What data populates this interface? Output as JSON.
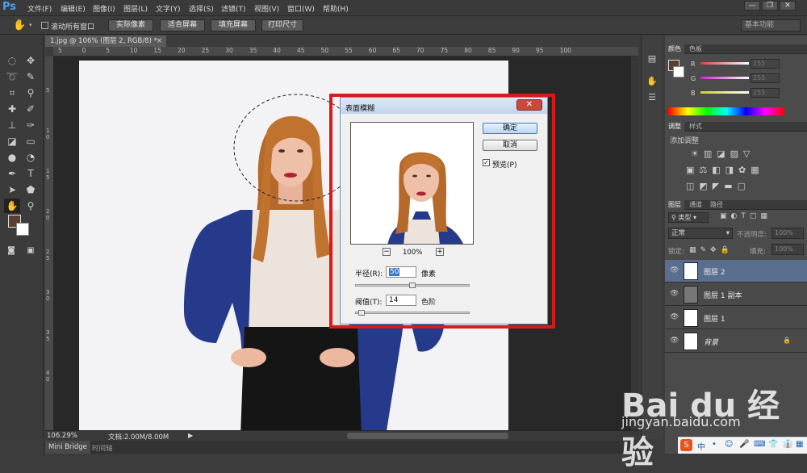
{
  "app": {
    "logo": "Ps"
  },
  "menu": [
    "文件(F)",
    "编辑(E)",
    "图像(I)",
    "图层(L)",
    "文字(Y)",
    "选择(S)",
    "滤镜(T)",
    "视图(V)",
    "窗口(W)",
    "帮助(H)"
  ],
  "window_controls": [
    "—",
    "❐",
    "✕"
  ],
  "options_bar": {
    "scroll_all_label": "滚动所有窗口",
    "buttons": [
      "实际像素",
      "适合屏幕",
      "填充屏幕",
      "打印尺寸"
    ],
    "workspace": "基本功能"
  },
  "document": {
    "tab_title": "1.jpg @ 106% (图层 2, RGB/8) *",
    "zoom": "106.29%",
    "doc_size": "文档:2.00M/8.00M"
  },
  "ruler_top": [
    "5",
    "0",
    "5",
    "10",
    "15",
    "20",
    "25",
    "30",
    "35",
    "40",
    "45",
    "50",
    "55",
    "60",
    "65",
    "70",
    "75",
    "80",
    "85",
    "90",
    "95",
    "100"
  ],
  "ruler_left": [
    "5",
    "1\n0",
    "1\n5",
    "2\n0",
    "2\n5",
    "3\n0",
    "3\n5",
    "4\n0"
  ],
  "bottom_tabs": [
    "Mini Bridge",
    "时间轴"
  ],
  "color_panel": {
    "tabs": [
      "颜色",
      "色板"
    ],
    "channels": [
      {
        "name": "R",
        "value": "255",
        "color": "#e04040"
      },
      {
        "name": "G",
        "value": "255",
        "color": "#40c040"
      },
      {
        "name": "B",
        "value": "255",
        "color": "#4060e0"
      }
    ]
  },
  "adjust_panel": {
    "tabs": [
      "调整",
      "样式"
    ],
    "title": "添加调整"
  },
  "layers_panel": {
    "tabs": [
      "图层",
      "通道",
      "路径"
    ],
    "kind_label": "类型",
    "blend_mode": "正常",
    "opacity_label": "不透明度:",
    "opacity": "100%",
    "lock_label": "锁定:",
    "fill_label": "填充:",
    "fill": "100%",
    "layers": [
      {
        "name": "图层 2",
        "selected": true
      },
      {
        "name": "图层 1 副本",
        "selected": false
      },
      {
        "name": "图层 1",
        "selected": false
      },
      {
        "name": "背景",
        "selected": false
      }
    ]
  },
  "dialog": {
    "title": "表面模糊",
    "ok": "确定",
    "cancel": "取消",
    "preview_label": "预览(P)",
    "zoom": "100%",
    "zoom_minus": "−",
    "zoom_plus": "+",
    "radius_label": "半径(R):",
    "radius_value": "50",
    "radius_unit": "像素",
    "threshold_label": "阈值(T):",
    "threshold_value": "14",
    "threshold_unit": "色阶",
    "radius_slider_fraction": 0.5,
    "threshold_slider_fraction": 0.03
  },
  "watermark": {
    "logo": "Bai du 经验",
    "url": "jingyan.baidu.com"
  },
  "ime_bar": [
    "S",
    "中",
    "•",
    "☺",
    "🎤",
    "⌨",
    "👕",
    "👔",
    "▦"
  ]
}
